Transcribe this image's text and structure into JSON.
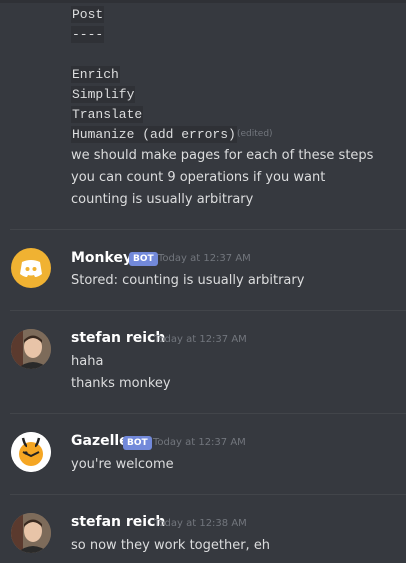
{
  "continued_message": {
    "code_lines": [
      "Post",
      "----",
      "Enrich",
      "Simplify",
      "Translate",
      "Humanize (add errors)"
    ],
    "edited_label": "(edited)",
    "text_lines": [
      "we should make pages for each of these steps",
      "you can count 9 operations if you want",
      "counting is usually arbitrary"
    ]
  },
  "messages": [
    {
      "author": "Monkey",
      "bot_badge": "BOT",
      "timestamp": "Today at 12:37 AM",
      "avatar_icon": "discord-logo-icon",
      "lines": [
        "Stored: counting is usually arbitrary"
      ]
    },
    {
      "author": "stefan reich",
      "timestamp": "Today at 12:37 AM",
      "avatar_icon": "user-photo-avatar",
      "lines": [
        "haha",
        "thanks monkey"
      ]
    },
    {
      "author": "Gazelle",
      "bot_badge": "BOT",
      "timestamp": "Today at 12:37 AM",
      "avatar_icon": "gazelle-avatar-icon",
      "lines": [
        "you're welcome"
      ]
    },
    {
      "author": "stefan reich",
      "timestamp": "Today at 12:38 AM",
      "avatar_icon": "user-photo-avatar",
      "lines": [
        "so now they work together, eh"
      ]
    }
  ],
  "colors": {
    "background": "#36393f",
    "text": "#dcddde",
    "username": "#ffffff",
    "timestamp": "#72767d",
    "bot_badge": "#7289da",
    "discord_avatar": "#f0b232",
    "gazelle_avatar": "#f5a623"
  }
}
